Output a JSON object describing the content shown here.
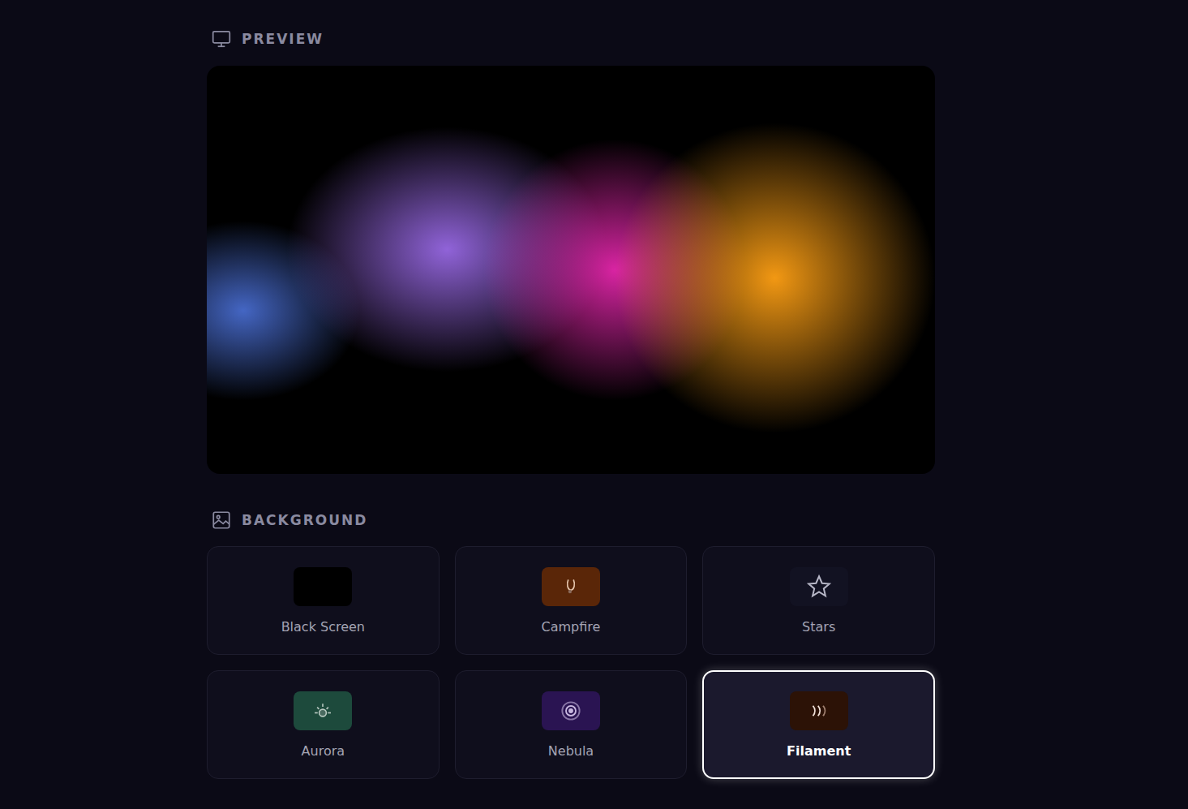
{
  "preview": {
    "title": "PREVIEW"
  },
  "background": {
    "title": "BACKGROUND",
    "options": [
      {
        "label": "Black Screen",
        "selected": false,
        "kind": "black",
        "color": "#000000"
      },
      {
        "label": "Campfire",
        "selected": false,
        "kind": "campfire",
        "color": "#5a2608"
      },
      {
        "label": "Stars",
        "selected": false,
        "kind": "stars",
        "color": "#121222"
      },
      {
        "label": "Aurora",
        "selected": false,
        "kind": "aurora",
        "color": "#1d4a3c"
      },
      {
        "label": "Nebula",
        "selected": false,
        "kind": "nebula",
        "color": "#2a1452"
      },
      {
        "label": "Filament",
        "selected": true,
        "kind": "filament",
        "color": "#2c1206"
      }
    ]
  }
}
